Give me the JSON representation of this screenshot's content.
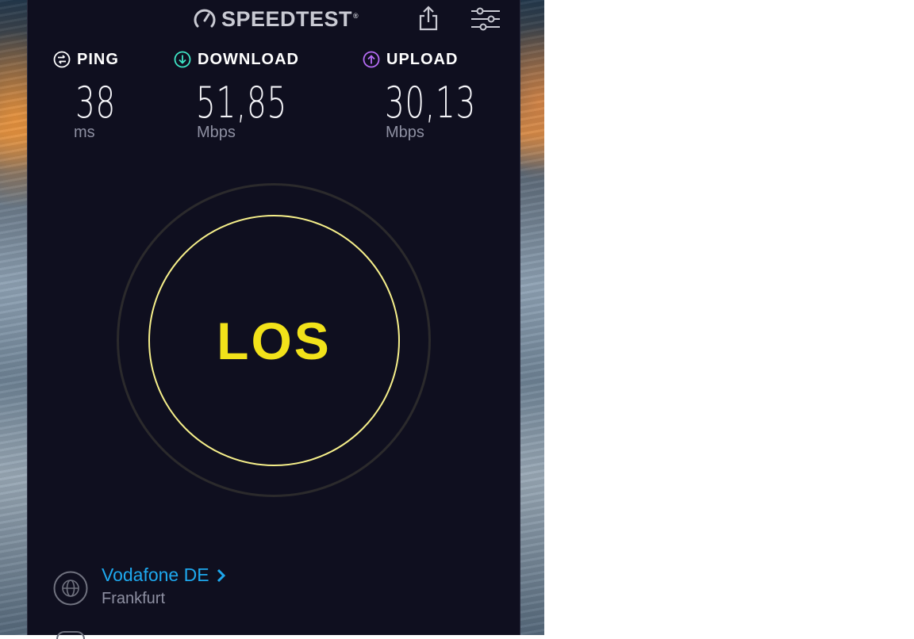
{
  "app": {
    "brand": "SPEEDTEST",
    "brand_mark": "®"
  },
  "metrics": {
    "ping": {
      "label": "PING",
      "value": "38",
      "unit": "ms",
      "icon": "ping-icon",
      "color": "#ffffff"
    },
    "download": {
      "label": "DOWNLOAD",
      "value": "51,85",
      "unit": "Mbps",
      "icon": "download-arrow-icon",
      "color": "#3ee6c6"
    },
    "upload": {
      "label": "UPLOAD",
      "value": "30,13",
      "unit": "Mbps",
      "icon": "upload-arrow-icon",
      "color": "#b66cf5"
    }
  },
  "start_button": {
    "label": "LOS",
    "text_color": "#f2e21a",
    "ring_color": "#f6ef8a"
  },
  "server": {
    "isp": "Vodafone DE",
    "location": "Frankfurt",
    "icon": "globe-icon",
    "link_color": "#1ea8ee"
  },
  "toolbar": {
    "share_icon": "share-icon",
    "settings_icon": "settings-sliders-icon"
  },
  "colors": {
    "background": "#0f0f1f",
    "unit_text": "#8e90a2"
  }
}
